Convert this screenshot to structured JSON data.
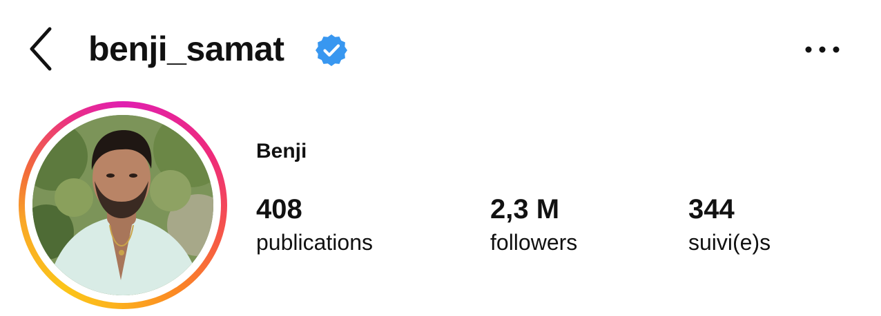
{
  "header": {
    "back_icon": "chevron-left-icon",
    "username": "benji_samat",
    "verified_icon": "verified-badge-icon",
    "verified_color": "#3897f0",
    "more_icon": "more-horizontal-icon"
  },
  "profile": {
    "avatar_ring_colors": [
      "#e01fb0",
      "#ee2a7b",
      "#f65a45",
      "#fcb21c"
    ],
    "display_name": "Benji",
    "stats": {
      "posts": {
        "count": "408",
        "label": "publications"
      },
      "followers": {
        "count": "2,3 M",
        "label": "followers"
      },
      "following": {
        "count": "344",
        "label": "suivi(e)s"
      }
    }
  }
}
